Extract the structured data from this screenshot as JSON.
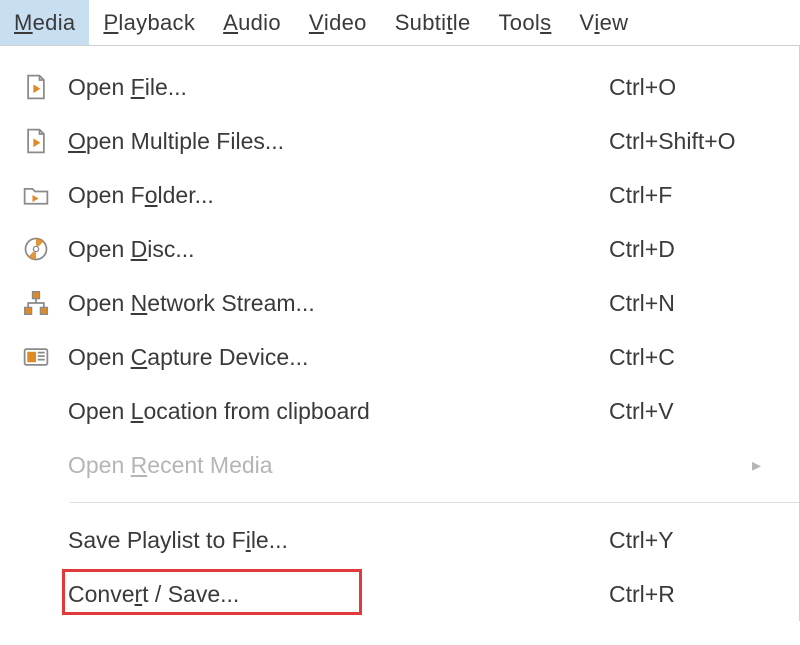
{
  "menubar": {
    "items": [
      {
        "label_pre": "",
        "mn": "M",
        "label_post": "edia",
        "active": true
      },
      {
        "label_pre": "",
        "mn": "P",
        "label_post": "layback",
        "active": false
      },
      {
        "label_pre": "",
        "mn": "A",
        "label_post": "udio",
        "active": false
      },
      {
        "label_pre": "",
        "mn": "V",
        "label_post": "ideo",
        "active": false
      },
      {
        "label_pre": "Subti",
        "mn": "t",
        "label_post": "le",
        "active": false
      },
      {
        "label_pre": "Tool",
        "mn": "s",
        "label_post": "",
        "active": false
      },
      {
        "label_pre": "V",
        "mn": "i",
        "label_post": "ew",
        "active": false
      }
    ]
  },
  "menu": {
    "items": [
      {
        "icon": "file-play",
        "label_pre": "Open ",
        "mn": "F",
        "label_post": "ile...",
        "shortcut": "Ctrl+O",
        "disabled": false
      },
      {
        "icon": "file-play",
        "label_pre": "",
        "mn": "O",
        "label_post": "pen Multiple Files...",
        "shortcut": "Ctrl+Shift+O",
        "disabled": false
      },
      {
        "icon": "folder-play",
        "label_pre": "Open F",
        "mn": "o",
        "label_post": "lder...",
        "shortcut": "Ctrl+F",
        "disabled": false
      },
      {
        "icon": "disc",
        "label_pre": "Open ",
        "mn": "D",
        "label_post": "isc...",
        "shortcut": "Ctrl+D",
        "disabled": false
      },
      {
        "icon": "network",
        "label_pre": "Open ",
        "mn": "N",
        "label_post": "etwork Stream...",
        "shortcut": "Ctrl+N",
        "disabled": false
      },
      {
        "icon": "capture",
        "label_pre": "Open ",
        "mn": "C",
        "label_post": "apture Device...",
        "shortcut": "Ctrl+C",
        "disabled": false
      },
      {
        "icon": "",
        "label_pre": "Open ",
        "mn": "L",
        "label_post": "ocation from clipboard",
        "shortcut": "Ctrl+V",
        "disabled": false
      },
      {
        "icon": "",
        "label_pre": "Open ",
        "mn": "R",
        "label_post": "ecent Media",
        "shortcut": "",
        "disabled": true,
        "submenu": true
      },
      {
        "separator": true
      },
      {
        "icon": "",
        "label_pre": "Save Playlist to F",
        "mn": "i",
        "label_post": "le...",
        "shortcut": "Ctrl+Y",
        "disabled": false
      },
      {
        "icon": "",
        "label_pre": "Conve",
        "mn": "r",
        "label_post": "t / Save...",
        "shortcut": "Ctrl+R",
        "disabled": false,
        "highlight": true
      }
    ]
  },
  "colors": {
    "highlight_box": "#e03a3a",
    "menubar_active_bg": "#c8dff2",
    "icon_accent": "#e08a25"
  }
}
